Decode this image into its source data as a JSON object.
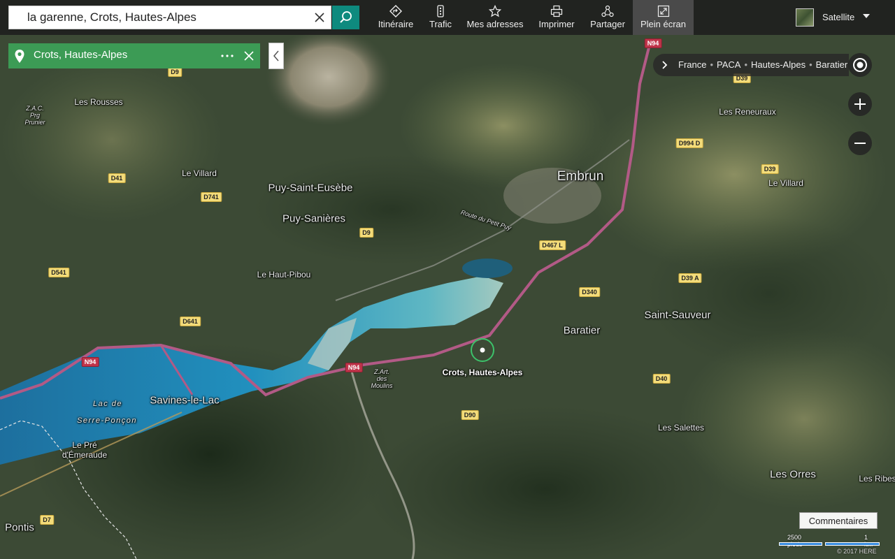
{
  "search": {
    "value": "la garenne, Crots, Hautes-Alpes"
  },
  "toolbar": {
    "items": [
      {
        "label": "Itinéraire"
      },
      {
        "label": "Trafic"
      },
      {
        "label": "Mes adresses"
      },
      {
        "label": "Imprimer"
      },
      {
        "label": "Partager"
      },
      {
        "label": "Plein écran"
      }
    ],
    "layer_label": "Satellite"
  },
  "result_card": {
    "title": "Crots, Hautes-Alpes"
  },
  "breadcrumb": {
    "items": [
      "France",
      "PACA",
      "Hautes-Alpes",
      "Baratier"
    ],
    "separator": "•"
  },
  "map": {
    "places": [
      {
        "text": "Les Rousses",
        "size": "s"
      },
      {
        "text": "Le Villard",
        "size": "s"
      },
      {
        "text": "Puy-Saint-Eusèbe",
        "size": "m"
      },
      {
        "text": "Puy-Sanières",
        "size": "m"
      },
      {
        "text": "Le Haut-Pibou",
        "size": "s"
      },
      {
        "text": "Embrun",
        "size": "l"
      },
      {
        "text": "Les Reneuraux",
        "size": "s"
      },
      {
        "text": "Le Villard",
        "size": "s"
      },
      {
        "text": "Saint-Sauveur",
        "size": "m"
      },
      {
        "text": "Baratier",
        "size": "m"
      },
      {
        "text": "Savines-le-Lac",
        "size": "m"
      },
      {
        "text": "Les Salettes",
        "size": "s"
      },
      {
        "text": "Les Orres",
        "size": "m"
      },
      {
        "text": "Les Ribes",
        "size": "s"
      },
      {
        "text": "Pontis",
        "size": "m"
      },
      {
        "text": "Le Pré",
        "size": "s"
      },
      {
        "text": "d'Émeraude",
        "size": "s"
      },
      {
        "text": "Lac de",
        "size": "it"
      },
      {
        "text": "Serre-Ponçon",
        "size": "it"
      },
      {
        "text": "Route du Petit Puy",
        "size": "tiny"
      }
    ],
    "tiny_labels": [
      {
        "lines": [
          "Z.A.C.",
          "Prg",
          "Prunier"
        ]
      },
      {
        "lines": [
          "Z.Art.",
          "des",
          "Moulins"
        ]
      }
    ],
    "roads": [
      {
        "text": "N94",
        "type": "red"
      },
      {
        "text": "D9",
        "type": "yellow"
      },
      {
        "text": "D39",
        "type": "yellow"
      },
      {
        "text": "D994 D",
        "type": "yellow"
      },
      {
        "text": "D39",
        "type": "yellow"
      },
      {
        "text": "D41",
        "type": "yellow"
      },
      {
        "text": "D741",
        "type": "yellow"
      },
      {
        "text": "D9",
        "type": "yellow"
      },
      {
        "text": "D467 L",
        "type": "yellow"
      },
      {
        "text": "D541",
        "type": "yellow"
      },
      {
        "text": "D39 A",
        "type": "yellow"
      },
      {
        "text": "D340",
        "type": "yellow"
      },
      {
        "text": "D641",
        "type": "yellow"
      },
      {
        "text": "N94",
        "type": "red"
      },
      {
        "text": "N94",
        "type": "red"
      },
      {
        "text": "D40",
        "type": "yellow"
      },
      {
        "text": "D90",
        "type": "yellow"
      },
      {
        "text": "D7",
        "type": "yellow"
      }
    ],
    "pin_label": "Crots, Hautes-Alpes"
  },
  "feedback_label": "Commentaires",
  "scale": {
    "imperial": "2500 pieds",
    "metric": "1 km"
  },
  "copyright": "© 2017 HERE",
  "colors": {
    "accent": "#0e8a7e",
    "card": "#3c9b55",
    "lake": "#2a8fbf",
    "road": "#b25a86"
  }
}
